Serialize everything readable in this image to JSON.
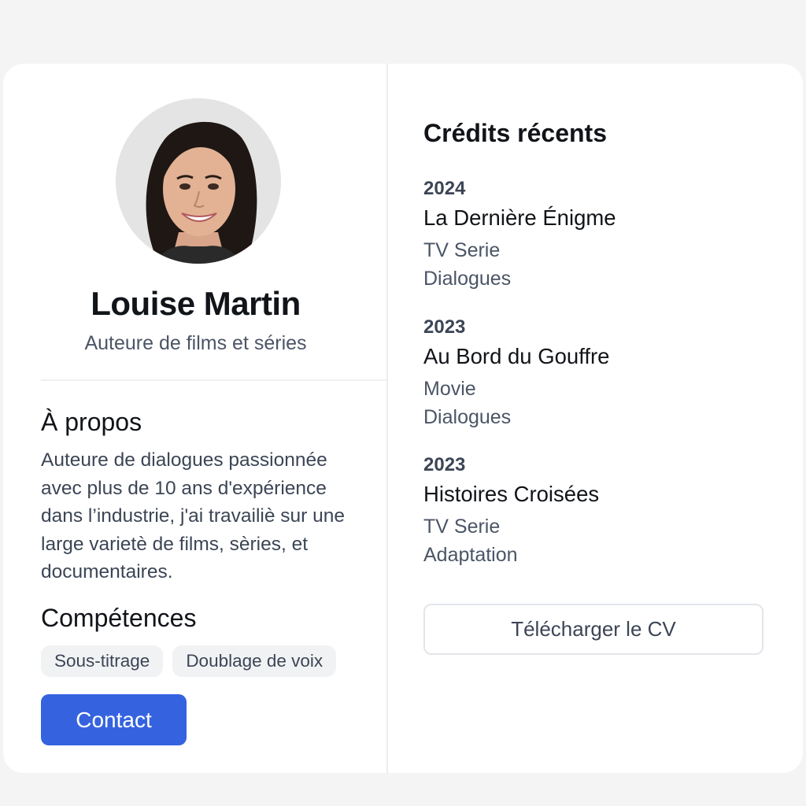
{
  "profile": {
    "name": "Louise Martin",
    "role": "Auteure de films et séries"
  },
  "about": {
    "title": "À propos",
    "text": "Auteure de dialogues passionnée avec plus de 10 ans d'expérience dans l’industrie, j'ai travailiè sur une large varietè de films, sèries, et documentaires."
  },
  "skills": {
    "title": "Compétences",
    "items": [
      "Sous-titrage",
      "Doublage de voix"
    ]
  },
  "actions": {
    "contact_label": "Contact",
    "cv_label": "Télécharger le CV"
  },
  "credits": {
    "title": "Crédits récents",
    "items": [
      {
        "year": "2024",
        "title": "La Dernière Énigme",
        "type": "TV Serie",
        "job": "Dialogues"
      },
      {
        "year": "2023",
        "title": "Au Bord du Gouffre",
        "type": "Movie",
        "job": "Dialogues"
      },
      {
        "year": "2023",
        "title": "Histoires Croisées",
        "type": "TV Serie",
        "job": "Adaptation"
      }
    ]
  },
  "colors": {
    "accent": "#3563e0",
    "page_bg": "#f4f4f5",
    "card_bg": "#ffffff"
  }
}
